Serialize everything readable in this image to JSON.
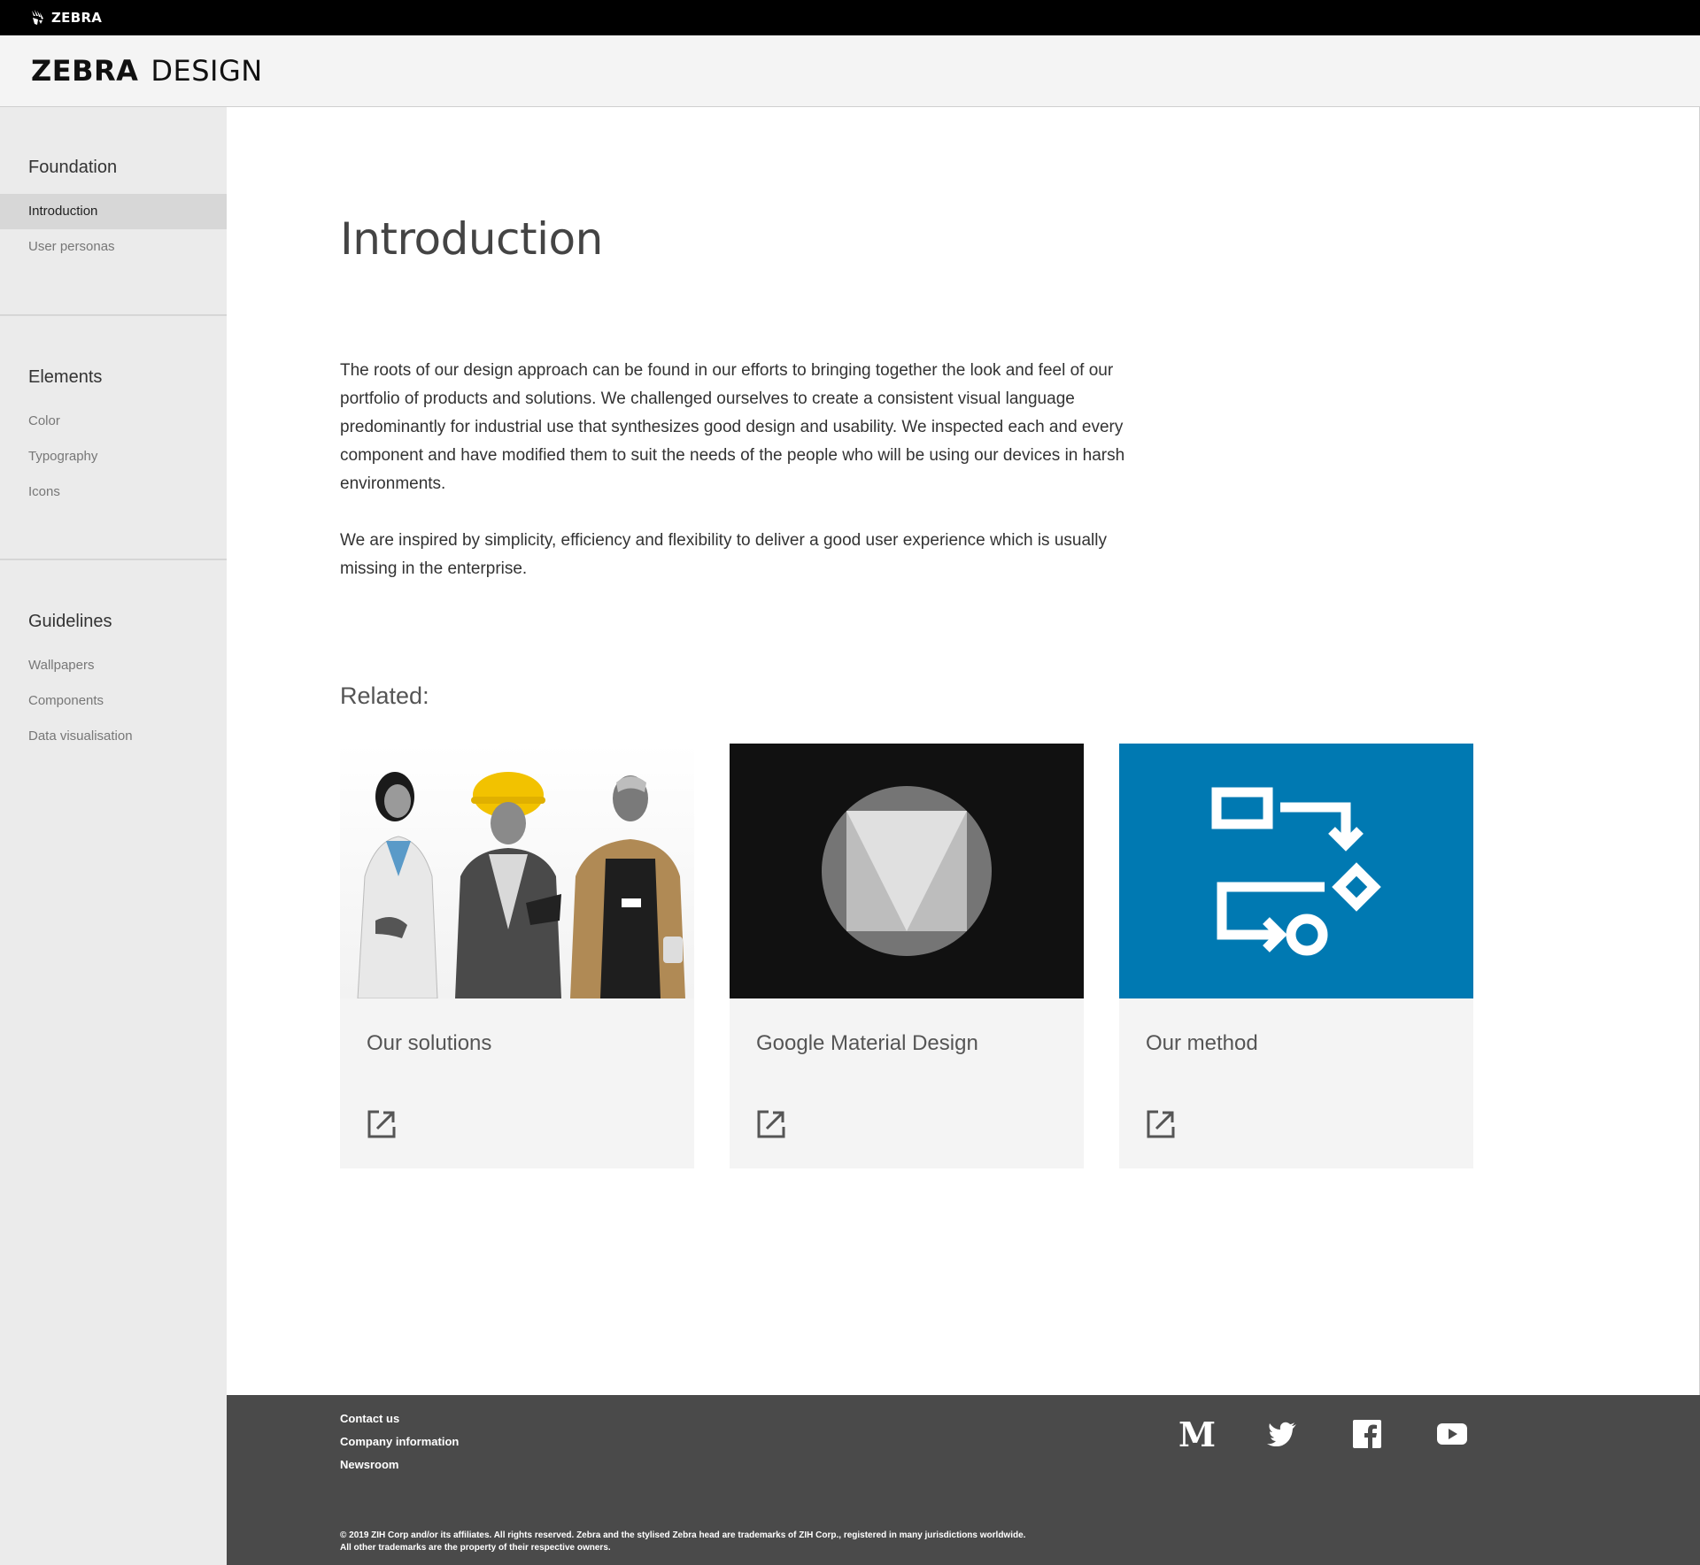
{
  "topbar": {
    "brand": "ZEBRA"
  },
  "header": {
    "logo_bold": "ZEBRA",
    "logo_light": "DESIGN"
  },
  "sidebar": {
    "sections": [
      {
        "title": "Foundation",
        "items": [
          "Introduction",
          "User personas"
        ]
      },
      {
        "title": "Elements",
        "items": [
          "Color",
          "Typography",
          "Icons"
        ]
      },
      {
        "title": "Guidelines",
        "items": [
          "Wallpapers",
          "Components",
          "Data visualisation"
        ]
      }
    ],
    "active_item": "Introduction"
  },
  "main": {
    "title": "Introduction",
    "paragraphs": [
      "The roots of our design approach can be found in our efforts to bringing together the look and feel of our portfolio of products and solutions. We challenged ourselves to create a consistent visual language predominantly for industrial use that synthesizes good design and usability. We inspected each and every component and have modified them to suit the needs of the people who will be using our devices in harsh environments.",
      "We are inspired by simplicity, efficiency and flexibility to deliver a good user experience which is usually missing in the enterprise."
    ],
    "related_title": "Related:",
    "cards": [
      {
        "label": "Our solutions",
        "image": "people-photo",
        "icon": "external-link-icon"
      },
      {
        "label": "Google Material Design",
        "image": "material-logo",
        "icon": "external-link-icon"
      },
      {
        "label": "Our method",
        "image": "method-flow-icon",
        "icon": "external-link-icon"
      }
    ]
  },
  "footer": {
    "links": [
      "Contact us",
      "Company information",
      "Newsroom"
    ],
    "social": [
      "medium-icon",
      "twitter-icon",
      "facebook-icon",
      "youtube-icon"
    ],
    "copyright_line1": "© 2019 ZIH Corp and/or its affiliates. All rights reserved. Zebra and the stylised Zebra head are trademarks of ZIH Corp., registered in many jurisdictions worldwide.",
    "copyright_line2": "All other trademarks are the property of their respective owners."
  },
  "colors": {
    "accent_blue": "#0079b2",
    "footer_bg": "#4a4a4a",
    "sidebar_bg": "#ebebeb"
  }
}
